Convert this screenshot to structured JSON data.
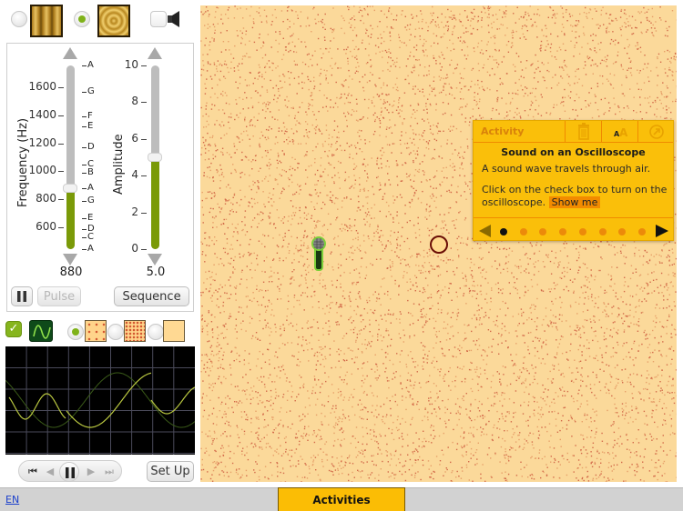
{
  "wave_type": {
    "options": [
      {
        "name": "plane-wave",
        "selected": false
      },
      {
        "name": "circular-wave",
        "selected": true
      }
    ],
    "sound_enabled": false
  },
  "frequency_slider": {
    "title": "Frequency (Hz)",
    "min": 440,
    "max": 1760,
    "value": 880,
    "readout": "880",
    "ticks": [
      "600",
      "800",
      "1000",
      "1200",
      "1400",
      "1600"
    ],
    "tick_values": [
      600,
      800,
      1000,
      1200,
      1400,
      1600
    ],
    "notes": [
      {
        "label": "A",
        "hz": 1760
      },
      {
        "label": "G",
        "hz": 1568
      },
      {
        "label": "F",
        "hz": 1397
      },
      {
        "label": "E",
        "hz": 1319
      },
      {
        "label": "D",
        "hz": 1175
      },
      {
        "label": "C",
        "hz": 1047
      },
      {
        "label": "B",
        "hz": 988
      },
      {
        "label": "A",
        "hz": 880
      },
      {
        "label": "G",
        "hz": 784
      },
      {
        "label": "E",
        "hz": 659
      },
      {
        "label": "D",
        "hz": 587
      },
      {
        "label": "C",
        "hz": 523
      },
      {
        "label": "A",
        "hz": 440
      }
    ]
  },
  "amplitude_slider": {
    "title": "Amplitude",
    "min": 0,
    "max": 10,
    "value": 5.0,
    "readout": "5.0",
    "ticks": [
      "0",
      "2",
      "4",
      "6",
      "8",
      "10"
    ],
    "tick_values": [
      0,
      2,
      4,
      6,
      8,
      10
    ]
  },
  "buttons": {
    "pause_icon": "pause-icon",
    "pulse": "Pulse",
    "sequence": "Sequence",
    "setup": "Set Up"
  },
  "scope_controls": {
    "oscilloscope_enabled": true,
    "media": [
      {
        "name": "air-sparse",
        "selected": true
      },
      {
        "name": "air-dense",
        "selected": false
      },
      {
        "name": "no-particles",
        "selected": false
      }
    ]
  },
  "activity_panel": {
    "header_label": "Activity",
    "title": "Sound on an Oscilloscope",
    "paragraph1": "A sound wave travels through air.",
    "paragraph2": "Click on the check box to turn on the oscilloscope.",
    "show_me": "Show me",
    "page_count": 8,
    "current_page": 1
  },
  "bottom_bar": {
    "language": "EN",
    "activities_tab": "Activities"
  },
  "colors": {
    "accent_green": "#7a9a08",
    "activity_yellow": "#fabf0a",
    "activity_orange": "#f08a00",
    "canvas_bg": "#fbd99a",
    "particle": "#c8463a"
  }
}
